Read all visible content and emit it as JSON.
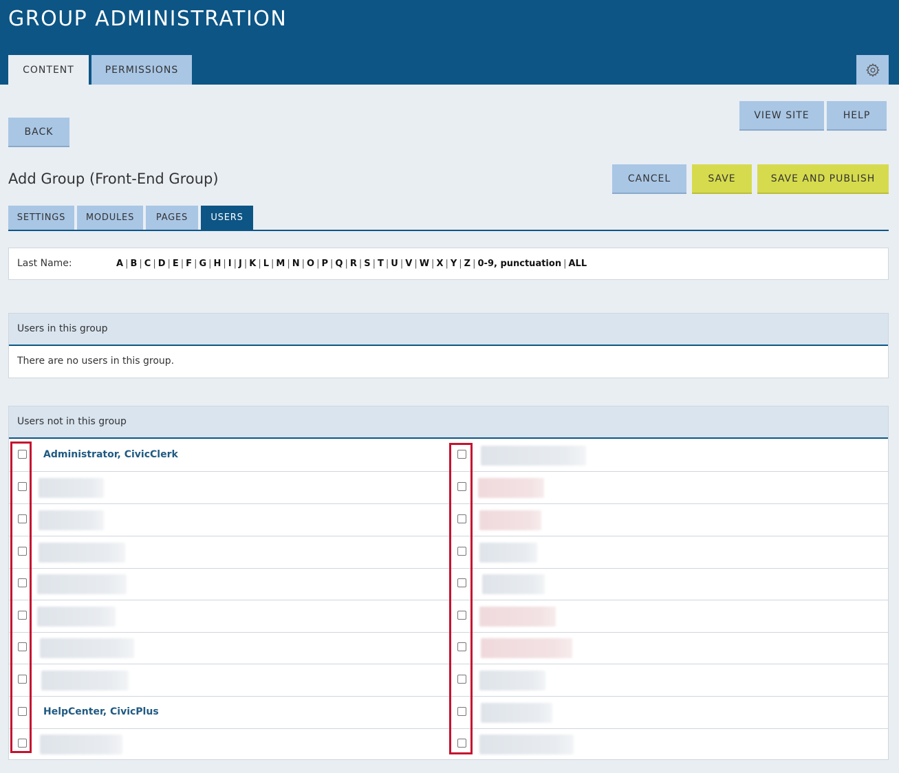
{
  "header": {
    "title": "GROUP ADMINISTRATION",
    "tabs": [
      {
        "label": "CONTENT",
        "active": true
      },
      {
        "label": "PERMISSIONS",
        "active": false
      }
    ],
    "settings_icon": "gear-icon"
  },
  "toolbar": {
    "view_site": "VIEW SITE",
    "help": "HELP",
    "back": "BACK",
    "cancel": "CANCEL",
    "save": "SAVE",
    "save_publish": "SAVE AND PUBLISH"
  },
  "page": {
    "title": "Add Group (Front-End Group)",
    "subtabs": [
      {
        "label": "SETTINGS",
        "active": false
      },
      {
        "label": "MODULES",
        "active": false
      },
      {
        "label": "PAGES",
        "active": false
      },
      {
        "label": "USERS",
        "active": true
      }
    ]
  },
  "filter": {
    "label": "Last Name:",
    "letters": [
      "A",
      "B",
      "C",
      "D",
      "E",
      "F",
      "G",
      "H",
      "I",
      "J",
      "K",
      "L",
      "M",
      "N",
      "O",
      "P",
      "Q",
      "R",
      "S",
      "T",
      "U",
      "V",
      "W",
      "X",
      "Y",
      "Z",
      "0-9, punctuation",
      "ALL"
    ]
  },
  "in_group": {
    "title": "Users in this group",
    "empty_message": "There are no users in this group."
  },
  "not_in_group": {
    "title": "Users not in this group",
    "left_users": [
      "Administrator, CivicClerk",
      "",
      "",
      "",
      "",
      "",
      "",
      "",
      "HelpCenter, CivicPlus",
      ""
    ],
    "right_users": [
      "",
      "",
      "",
      "",
      "",
      "",
      "",
      "",
      "",
      ""
    ]
  },
  "colors": {
    "header_bg": "#0c5585",
    "tab_bg": "#a9c6e5",
    "save_bg": "#d6db4d",
    "highlight": "#c4122f",
    "link": "#205a82"
  }
}
